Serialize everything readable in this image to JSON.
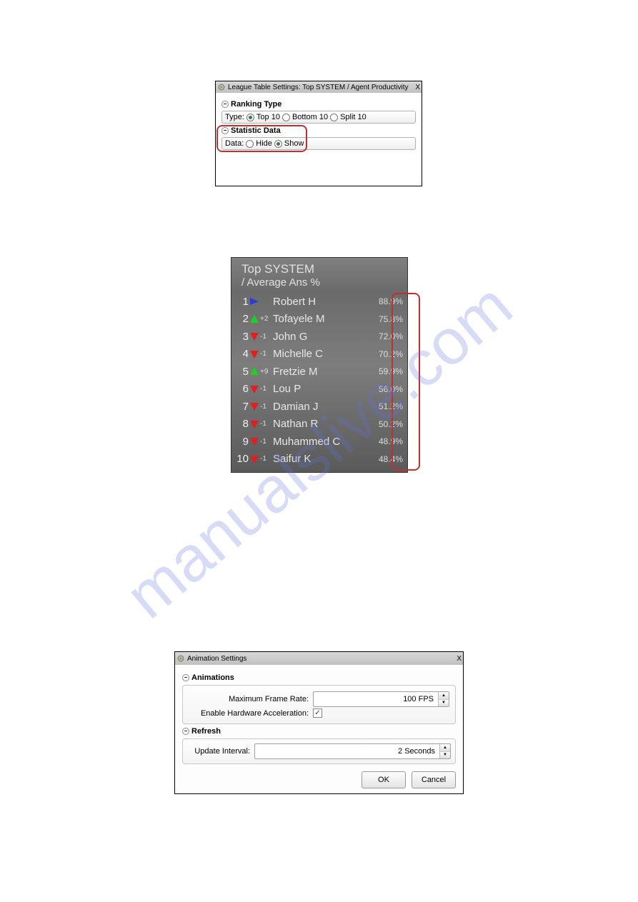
{
  "watermark": "manualslive.com",
  "dlg1": {
    "title": "League Table Settings: Top SYSTEM / Agent Productivity",
    "close": "X",
    "section1": {
      "header": "Ranking Type",
      "label": "Type:",
      "options": [
        {
          "label": "Top 10",
          "selected": true
        },
        {
          "label": "Bottom 10",
          "selected": false
        },
        {
          "label": "Split 10",
          "selected": false
        }
      ]
    },
    "section2": {
      "header": "Statistic Data",
      "label": "Data:",
      "options": [
        {
          "label": "Hide",
          "selected": false
        },
        {
          "label": "Show",
          "selected": true
        }
      ]
    }
  },
  "league": {
    "title1": "Top SYSTEM",
    "title2": "/ Average Ans %",
    "rows": [
      {
        "rank": "1",
        "arrow": "right",
        "delta": "",
        "name": "Robert H",
        "pct": "88.9%"
      },
      {
        "rank": "2",
        "arrow": "up",
        "delta": "+2",
        "name": "Tofayele M",
        "pct": "75.8%"
      },
      {
        "rank": "3",
        "arrow": "down",
        "delta": "-1",
        "name": "John G",
        "pct": "72.0%"
      },
      {
        "rank": "4",
        "arrow": "down",
        "delta": "-1",
        "name": "Michelle C",
        "pct": "70.2%"
      },
      {
        "rank": "5",
        "arrow": "up",
        "delta": "+9",
        "name": "Fretzie M",
        "pct": "59.9%"
      },
      {
        "rank": "6",
        "arrow": "down",
        "delta": "-1",
        "name": "Lou P",
        "pct": "56.0%"
      },
      {
        "rank": "7",
        "arrow": "down",
        "delta": "-1",
        "name": "Damian J",
        "pct": "51.2%"
      },
      {
        "rank": "8",
        "arrow": "down",
        "delta": "-1",
        "name": "Nathan R",
        "pct": "50.2%"
      },
      {
        "rank": "9",
        "arrow": "down",
        "delta": "-1",
        "name": "Muhammed C",
        "pct": "48.9%"
      },
      {
        "rank": "10",
        "arrow": "down",
        "delta": "-1",
        "name": "Saifur K",
        "pct": "48.4%"
      }
    ]
  },
  "dlg2": {
    "title": "Animation Settings",
    "close": "X",
    "animations": {
      "header": "Animations",
      "framerate_label": "Maximum Frame Rate:",
      "framerate_value": "100 FPS",
      "hwaccel_label": "Enable Hardware Acceleration:",
      "hwaccel_checked": true
    },
    "refresh": {
      "header": "Refresh",
      "interval_label": "Update Interval:",
      "interval_value": "2 Seconds"
    },
    "ok": "OK",
    "cancel": "Cancel"
  }
}
